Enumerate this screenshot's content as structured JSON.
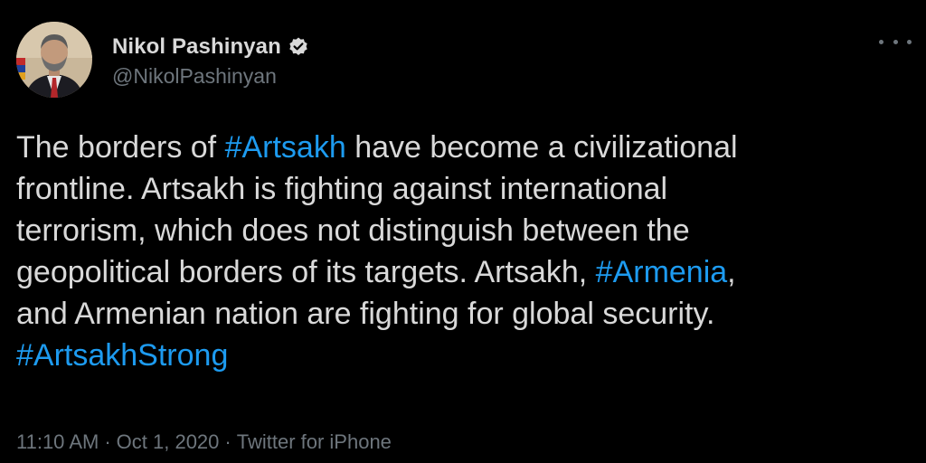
{
  "author": {
    "display_name": "Nikol Pashinyan",
    "handle": "@NikolPashinyan",
    "verified": true,
    "verified_icon": "verified-badge-icon"
  },
  "more_icon": "more-horizontal-icon",
  "tweet": {
    "lines": [
      [
        {
          "t": "The borders of ",
          "tag": false
        },
        {
          "t": "#Artsakh",
          "tag": true
        },
        {
          "t": " have become a civilizational",
          "tag": false
        }
      ],
      [
        {
          "t": "frontline. Artsakh is fighting against international",
          "tag": false
        }
      ],
      [
        {
          "t": "terrorism, which does not distinguish between the",
          "tag": false
        }
      ],
      [
        {
          "t": "geopolitical borders of its targets. Artsakh, ",
          "tag": false
        },
        {
          "t": "#Armenia",
          "tag": true
        },
        {
          "t": ",",
          "tag": false
        }
      ],
      [
        {
          "t": "and Armenian nation are fighting for global security.",
          "tag": false
        }
      ],
      [
        {
          "t": "#ArtsakhStrong",
          "tag": true
        }
      ]
    ]
  },
  "meta": {
    "time": "11:10 AM",
    "date": "Oct 1, 2020",
    "source": "Twitter for iPhone",
    "separator": "·"
  },
  "colors": {
    "background": "#000000",
    "text": "#d9d9d9",
    "secondary": "#6e767d",
    "link": "#1d9bf0"
  }
}
